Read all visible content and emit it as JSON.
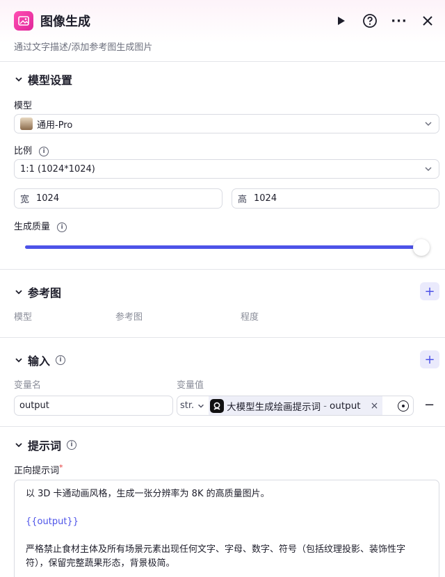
{
  "header": {
    "title": "图像生成",
    "subtitle": "通过文字描述/添加参考图生成图片",
    "more_label": "···"
  },
  "model_settings": {
    "section_title": "模型设置",
    "model_label": "模型",
    "model_value": "通用-Pro",
    "ratio_label": "比例",
    "ratio_value": "1:1 (1024*1024)",
    "width_prefix": "宽",
    "width_value": "1024",
    "height_prefix": "高",
    "height_value": "1024",
    "quality_label": "生成质量",
    "quality_value": 1.0
  },
  "reference": {
    "section_title": "参考图",
    "columns": [
      "模型",
      "参考图",
      "程度"
    ]
  },
  "input": {
    "section_title": "输入",
    "col_name": "变量名",
    "col_value": "变量值",
    "var_name": "output",
    "type_label": "str.",
    "ref_source": "大模型生成绘画提示词",
    "ref_sep": "-",
    "ref_var": "output",
    "clear_label": "×",
    "remove_label": "−"
  },
  "prompt": {
    "section_title": "提示词",
    "positive_label": "正向提示词",
    "required_mark": "*",
    "line1": "以 3D 卡通动画风格，生成一张分辨率为 8K 的高质量图片。",
    "line2": "{{output}}",
    "line3": "严格禁止食材主体及所有场景元素出现任何文字、字母、数字、符号（包括纹理投影、装饰性字符），保留完整蔬果形态，背景极简。"
  },
  "colors": {
    "accent": "#4d53e8",
    "brand_pink": "#e0259a",
    "slider": "#4d53e8"
  }
}
